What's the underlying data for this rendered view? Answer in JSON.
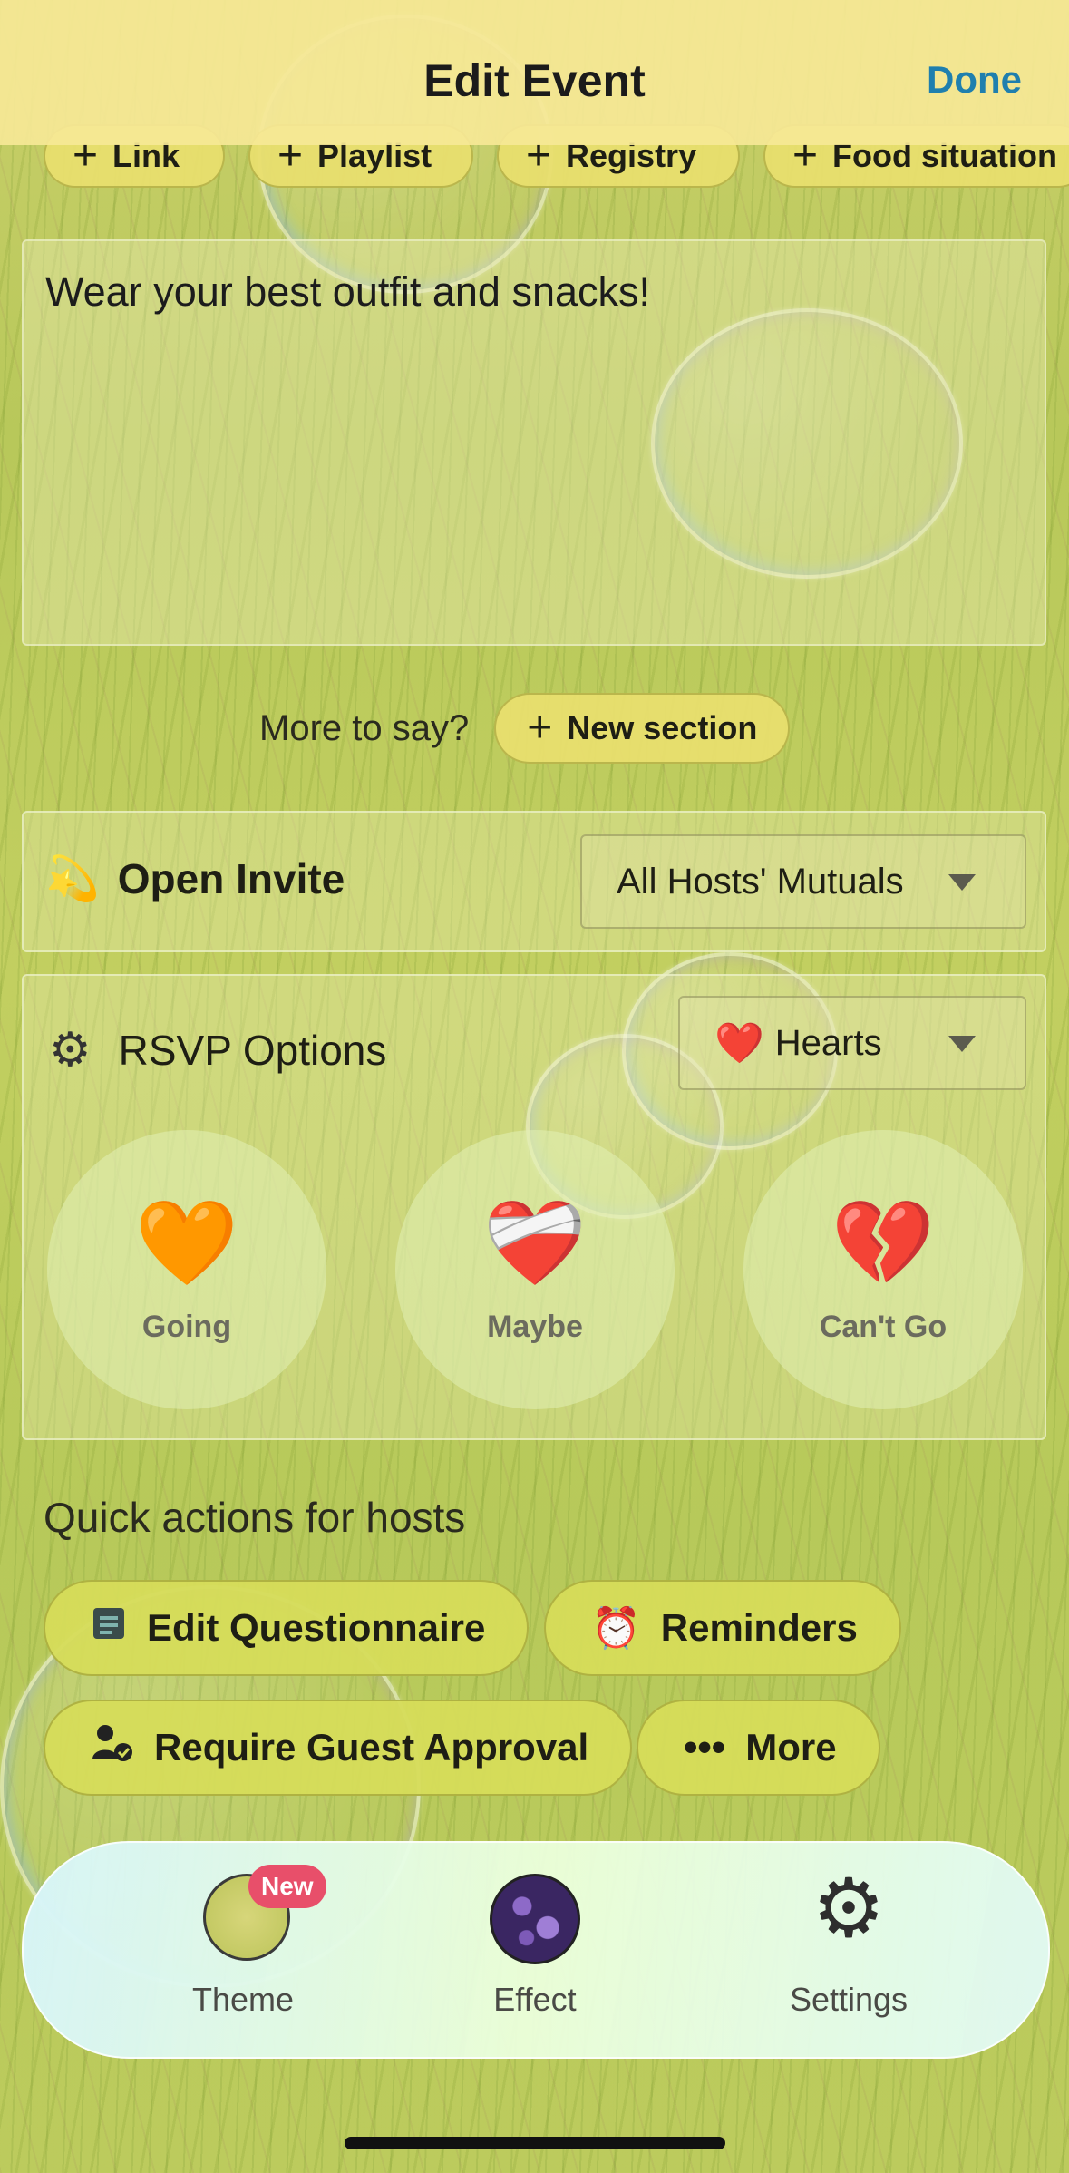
{
  "header": {
    "title": "Edit Event",
    "done_label": "Done"
  },
  "chips": [
    {
      "label": "Link"
    },
    {
      "label": "Playlist"
    },
    {
      "label": "Registry"
    },
    {
      "label": "Food situation"
    }
  ],
  "description": {
    "text": "Wear your best outfit and snacks!"
  },
  "more": {
    "label": "More to say?",
    "button_label": "New section"
  },
  "open_invite": {
    "emoji": "💫",
    "label": "Open Invite",
    "selected": "All Hosts' Mutuals"
  },
  "rsvp": {
    "label": "RSVP Options",
    "style_emoji": "❤️",
    "style_selected": "Hearts",
    "options": [
      {
        "emoji": "🧡",
        "label": "Going"
      },
      {
        "emoji": "❤️‍🩹",
        "label": "Maybe"
      },
      {
        "emoji": "💔",
        "label": "Can't Go"
      }
    ]
  },
  "quick_actions": {
    "title": "Quick actions for hosts",
    "items": [
      {
        "label": "Edit Questionnaire",
        "icon": "questionnaire-icon"
      },
      {
        "label": "Reminders",
        "icon": "alarm-clock-icon"
      },
      {
        "label": "Require Guest Approval",
        "icon": "guest-approval-icon"
      },
      {
        "label": "More",
        "icon": "ellipsis-icon"
      }
    ]
  },
  "tabbar": {
    "theme_label": "Theme",
    "theme_badge": "New",
    "effect_label": "Effect",
    "settings_label": "Settings"
  },
  "colors": {
    "accent": "#1f7fae",
    "badge": "#e84f6a",
    "chip_bg": "#e8de6e"
  }
}
